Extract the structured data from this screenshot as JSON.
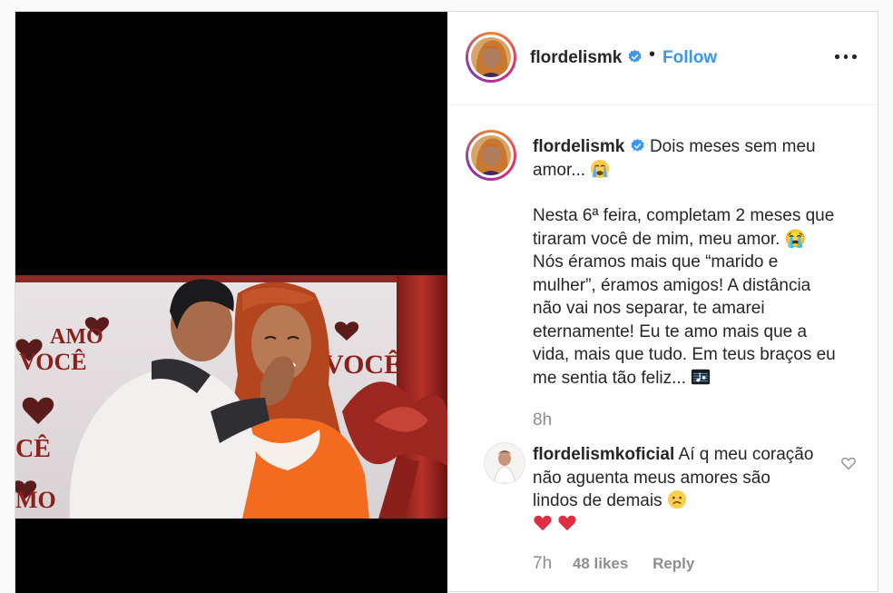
{
  "header": {
    "username": "flordelismk",
    "separator": "•",
    "follow_label": "Follow"
  },
  "caption": {
    "username": "flordelismk",
    "line1": "Dois meses sem meu amor...",
    "body": "Nesta 6ª feira, completam 2 meses que tiraram você de mim, meu amor. 😭 Nós éramos mais que “marido e mulher”, éramos amigos! A distância não vai nos separar, te amarei eternamente! Eu te amo mais que a vida, mais que tudo. Em teus braços eu me sentia tão feliz...",
    "time": "8h"
  },
  "photo": {
    "sign_left": "AMO",
    "sign_left2": "VOCÊ",
    "sign_right": "VOCÊ"
  },
  "comment": {
    "username": "flordelismkoficial",
    "text": "Aí q meu coração não aguenta meus amores são lindos de demais",
    "time": "7h",
    "likes": "48 likes",
    "reply_label": "Reply"
  },
  "colors": {
    "link_blue": "#3897f0",
    "verified_blue": "#3897f0",
    "muted_text": "#8e8e8e",
    "text": "#262626"
  },
  "icons": {
    "verified": "verified-badge-icon",
    "more": "more-options-icon",
    "like": "heart-outline-icon",
    "crying": "crying-face-emoji",
    "music": "musical-score-emoji",
    "sad": "sad-face-emoji",
    "hearts": "red-heart-emoji"
  }
}
